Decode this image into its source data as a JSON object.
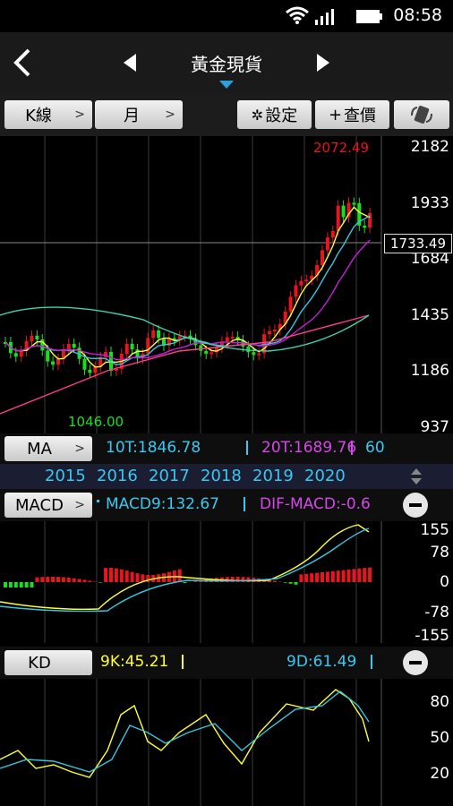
{
  "status": {
    "time": "08:58"
  },
  "nav": {
    "title": "黃金現貨"
  },
  "toolbar": {
    "k_label": "K線",
    "period_label": "月",
    "settings_label": "設定",
    "quote_label": "查價",
    "plus": "+"
  },
  "price_chart": {
    "high_label": "2072.49",
    "low_label": "1046.00",
    "current_label": "1733.49",
    "y_ticks": [
      "2182",
      "1933",
      "1684",
      "1435",
      "1186",
      "937"
    ]
  },
  "ma_bar": {
    "button": "MA",
    "ma10": "10T:1846.78",
    "ma20": "20T:1689.76",
    "ma60": "60"
  },
  "years": [
    "2015",
    "2016",
    "2017",
    "2018",
    "2019",
    "2020"
  ],
  "macd_bar": {
    "button": "MACD",
    "macd9": "MACD9:132.67",
    "dif": "DIF-MACD:-0.6"
  },
  "macd_axis": [
    "155",
    "78",
    "0",
    "-78",
    "-155"
  ],
  "kd_bar": {
    "button": "KD",
    "k": "9K:45.21",
    "d": "9D:61.49"
  },
  "kd_axis": [
    "80",
    "50",
    "20"
  ],
  "colors": {
    "up": "#e8141e",
    "down": "#18e020",
    "yellow": "#ffff33",
    "cyan": "#33c6e0",
    "magenta": "#c21fd6",
    "pink": "#ff3c8c",
    "label_cyan": "#39c8f0",
    "label_magenta": "#d447e8"
  }
}
